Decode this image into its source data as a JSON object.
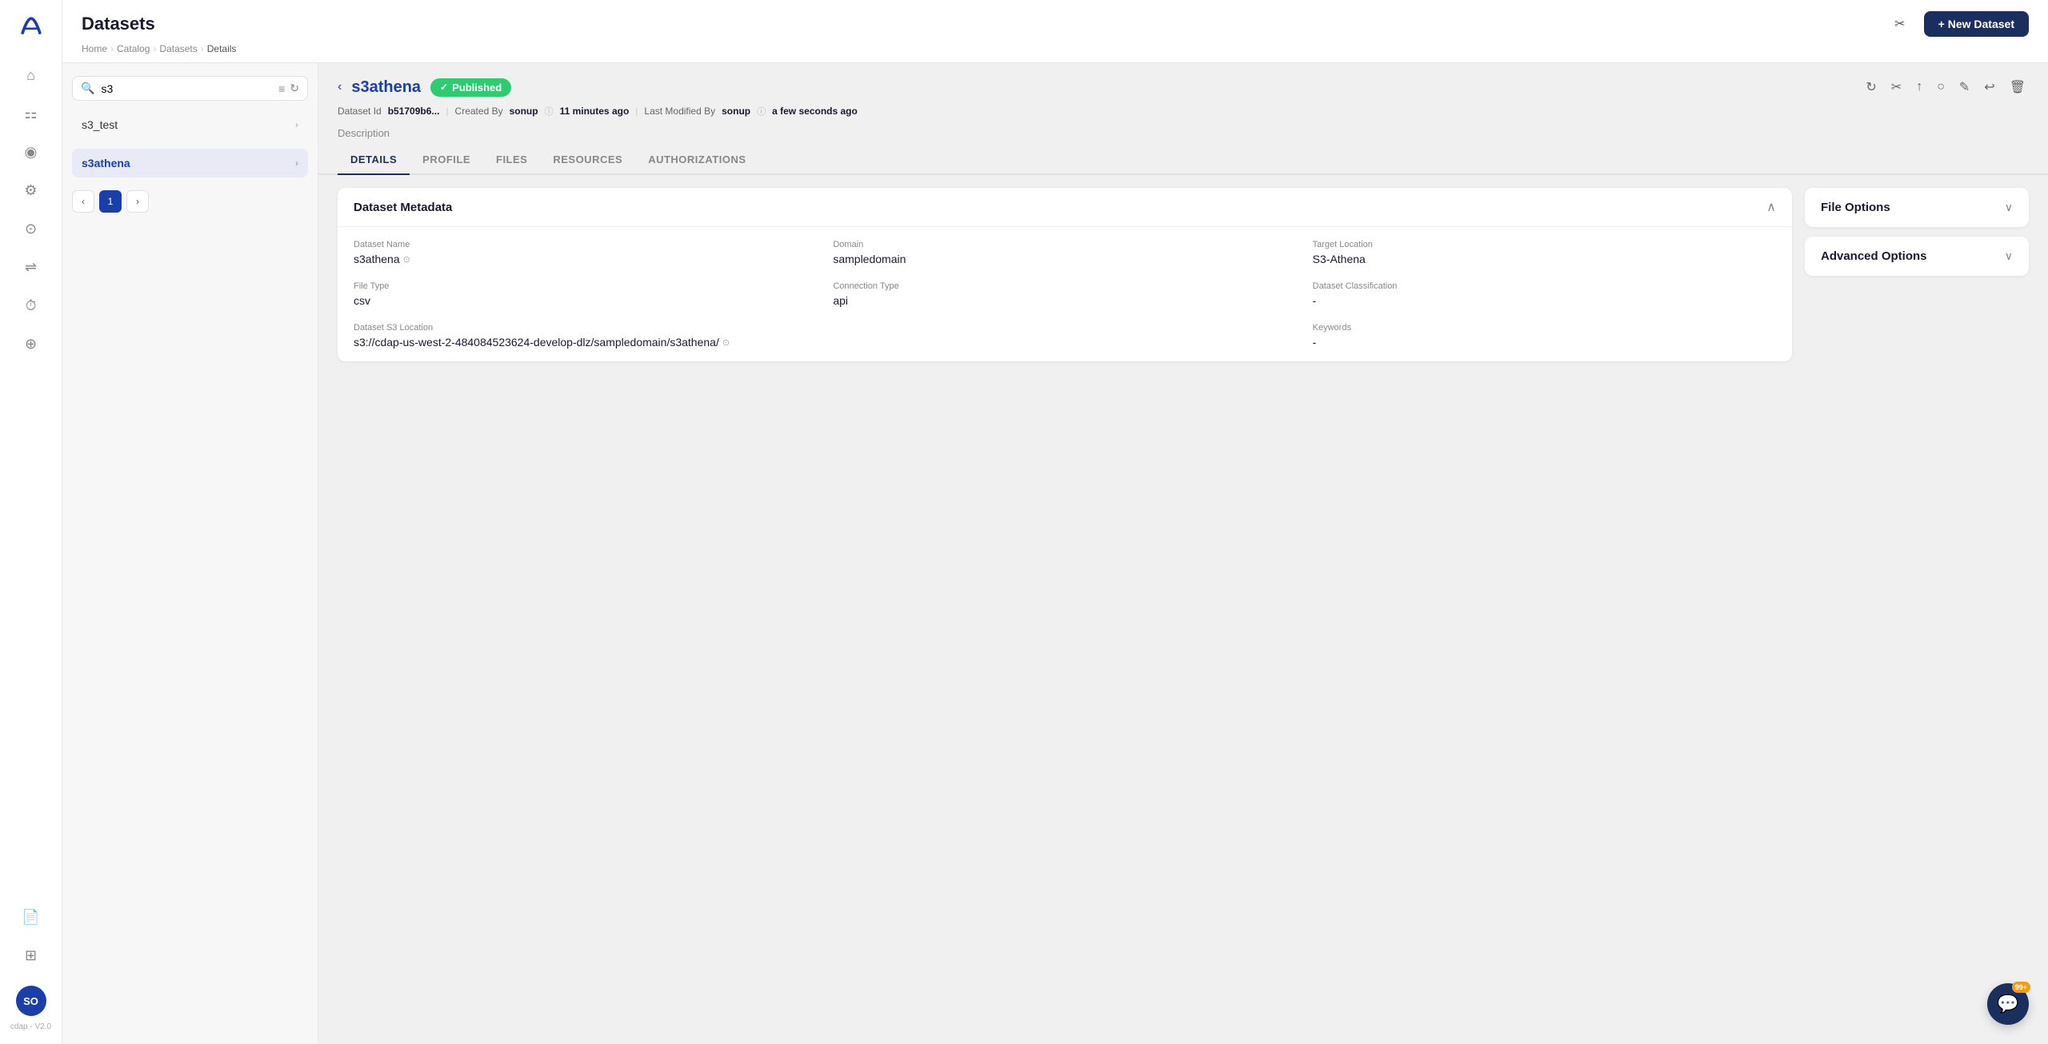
{
  "app": {
    "logo_text": "A",
    "version": "cdap - V2.0",
    "avatar": "SO"
  },
  "header": {
    "title": "Datasets",
    "breadcrumb": [
      "Home",
      "Catalog",
      "Datasets",
      "Details"
    ],
    "new_dataset_label": "+ New Dataset"
  },
  "sidebar": {
    "icons": [
      {
        "name": "home-icon",
        "symbol": "⌂",
        "active": false
      },
      {
        "name": "filter-icon",
        "symbol": "⊟",
        "active": false
      },
      {
        "name": "group-icon",
        "symbol": "◎",
        "active": false
      },
      {
        "name": "settings-icon",
        "symbol": "⚙",
        "active": false
      },
      {
        "name": "user-icon",
        "symbol": "⊙",
        "active": false
      },
      {
        "name": "flow-icon",
        "symbol": "⇌",
        "active": false
      },
      {
        "name": "history-icon",
        "symbol": "⏱",
        "active": false
      },
      {
        "name": "storage-icon",
        "symbol": "⊕",
        "active": false
      },
      {
        "name": "doc-icon",
        "symbol": "📄",
        "active": false
      },
      {
        "name": "grid-icon",
        "symbol": "⊞",
        "active": false
      }
    ]
  },
  "search": {
    "value": "s3",
    "placeholder": "s3"
  },
  "dataset_list": [
    {
      "name": "s3_test",
      "selected": false
    },
    {
      "name": "s3athena",
      "selected": true
    }
  ],
  "pagination": {
    "current": 1,
    "prev_label": "‹",
    "next_label": "›"
  },
  "dataset": {
    "back_label": "‹",
    "name": "s3athena",
    "status": "Published",
    "id_label": "Dataset Id",
    "id_value": "b51709b6...",
    "created_by_label": "Created By",
    "created_by": "sonup",
    "created_time": "11 minutes ago",
    "modified_by_label": "Last Modified By",
    "modified_by": "sonup",
    "modified_time": "a few seconds ago",
    "description_label": "Description"
  },
  "tabs": [
    {
      "label": "DETAILS",
      "active": true
    },
    {
      "label": "PROFILE",
      "active": false
    },
    {
      "label": "FILES",
      "active": false
    },
    {
      "label": "RESOURCES",
      "active": false
    },
    {
      "label": "AUTHORIZATIONS",
      "active": false
    }
  ],
  "metadata_card": {
    "title": "Dataset Metadata",
    "fields": [
      {
        "label": "Dataset Name",
        "value": "s3athena",
        "has_copy": true,
        "span": 1
      },
      {
        "label": "Domain",
        "value": "sampledomain",
        "has_copy": false,
        "span": 1
      },
      {
        "label": "Target Location",
        "value": "S3-Athena",
        "has_copy": false,
        "span": 1
      },
      {
        "label": "File Type",
        "value": "csv",
        "has_copy": false,
        "span": 1
      },
      {
        "label": "Connection Type",
        "value": "api",
        "has_copy": false,
        "span": 1
      },
      {
        "label": "Dataset Classification",
        "value": "-",
        "has_copy": false,
        "span": 1
      },
      {
        "label": "Dataset S3 Location",
        "value": "s3://cdap-us-west-2-484084523624-develop-dlz/sampledomain/s3athena/",
        "has_copy": true,
        "span": 2
      },
      {
        "label": "Keywords",
        "value": "-",
        "has_copy": false,
        "span": 1
      }
    ]
  },
  "side_cards": [
    {
      "title": "File Options",
      "expanded": false
    },
    {
      "title": "Advanced Options",
      "expanded": false
    }
  ],
  "toolbar_icons": [
    {
      "name": "refresh-icon",
      "symbol": "↻"
    },
    {
      "name": "cut-icon",
      "symbol": "✂"
    },
    {
      "name": "upload-icon",
      "symbol": "↑"
    },
    {
      "name": "circle-icon",
      "symbol": "○"
    },
    {
      "name": "edit-icon",
      "symbol": "✎"
    },
    {
      "name": "undo-icon",
      "symbol": "↩"
    },
    {
      "name": "delete-icon",
      "symbol": "🗑"
    }
  ],
  "chat": {
    "badge": "99+",
    "icon": "💬"
  }
}
